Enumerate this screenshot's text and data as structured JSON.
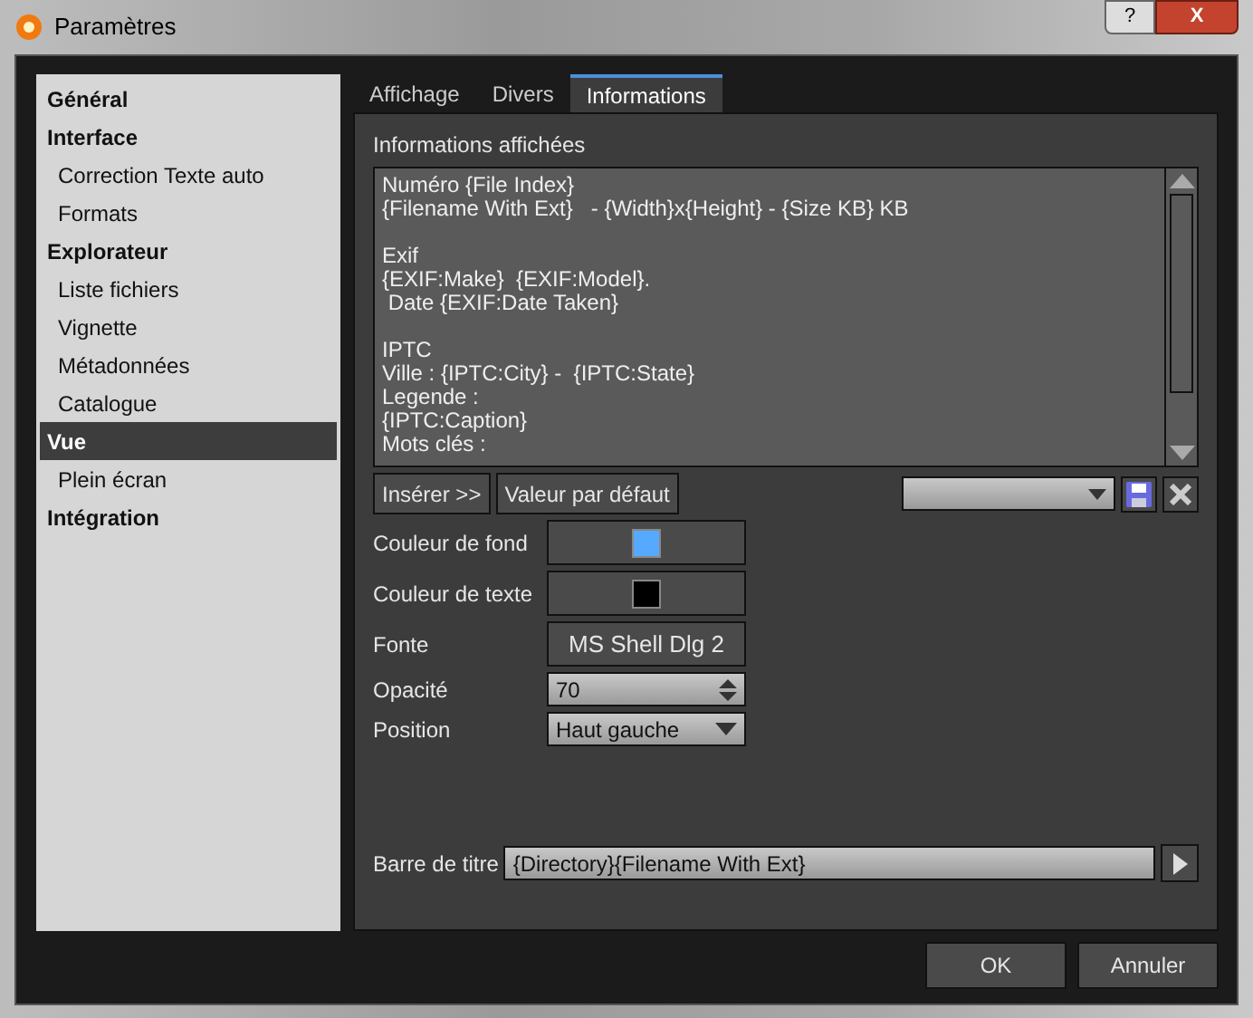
{
  "window": {
    "title": "Paramètres",
    "buttons": [
      "?",
      "X"
    ]
  },
  "sidebar": {
    "items": [
      {
        "label": "Général",
        "kind": "section",
        "selected": false
      },
      {
        "label": "Interface",
        "kind": "section",
        "selected": false
      },
      {
        "label": "Correction Texte auto",
        "kind": "item",
        "selected": false
      },
      {
        "label": "Formats",
        "kind": "item",
        "selected": false
      },
      {
        "label": "Explorateur",
        "kind": "section",
        "selected": false
      },
      {
        "label": "Liste fichiers",
        "kind": "item",
        "selected": false
      },
      {
        "label": "Vignette",
        "kind": "item",
        "selected": false
      },
      {
        "label": "Métadonnées",
        "kind": "item",
        "selected": false
      },
      {
        "label": "Catalogue",
        "kind": "item",
        "selected": false
      },
      {
        "label": "Vue",
        "kind": "section",
        "selected": true
      },
      {
        "label": "Plein écran",
        "kind": "item",
        "selected": false
      },
      {
        "label": "Intégration",
        "kind": "section",
        "selected": false
      }
    ]
  },
  "tabs": [
    {
      "label": "Affichage",
      "selected": false
    },
    {
      "label": "Divers",
      "selected": false
    },
    {
      "label": "Informations",
      "selected": true
    }
  ],
  "info": {
    "label": "Informations affichées",
    "value": "Numéro {File Index}\n{Filename With Ext}   - {Width}x{Height} - {Size KB} KB\n\nExif\n{EXIF:Make}  {EXIF:Model}.\n Date {EXIF:Date Taken}\n\nIPTC\nVille : {IPTC:City} -  {IPTC:State}\nLegende :\n{IPTC:Caption}\nMots clés :"
  },
  "insert_button": "Insérer >>",
  "default_button": "Valeur par défaut",
  "background_color": {
    "label": "Couleur de fond",
    "color": "#55aaff"
  },
  "text_color": {
    "label": "Couleur de texte",
    "color": "#000000"
  },
  "font": {
    "label": "Fonte",
    "value": "MS Shell Dlg 2"
  },
  "opacity": {
    "label": "Opacité",
    "value": "70"
  },
  "position": {
    "label": "Position",
    "value": "Haut gauche"
  },
  "title_bar": {
    "label": "Barre de titre",
    "value": "{Directory}{Filename With Ext}"
  },
  "buttons": [
    "OK",
    "Annuler"
  ]
}
